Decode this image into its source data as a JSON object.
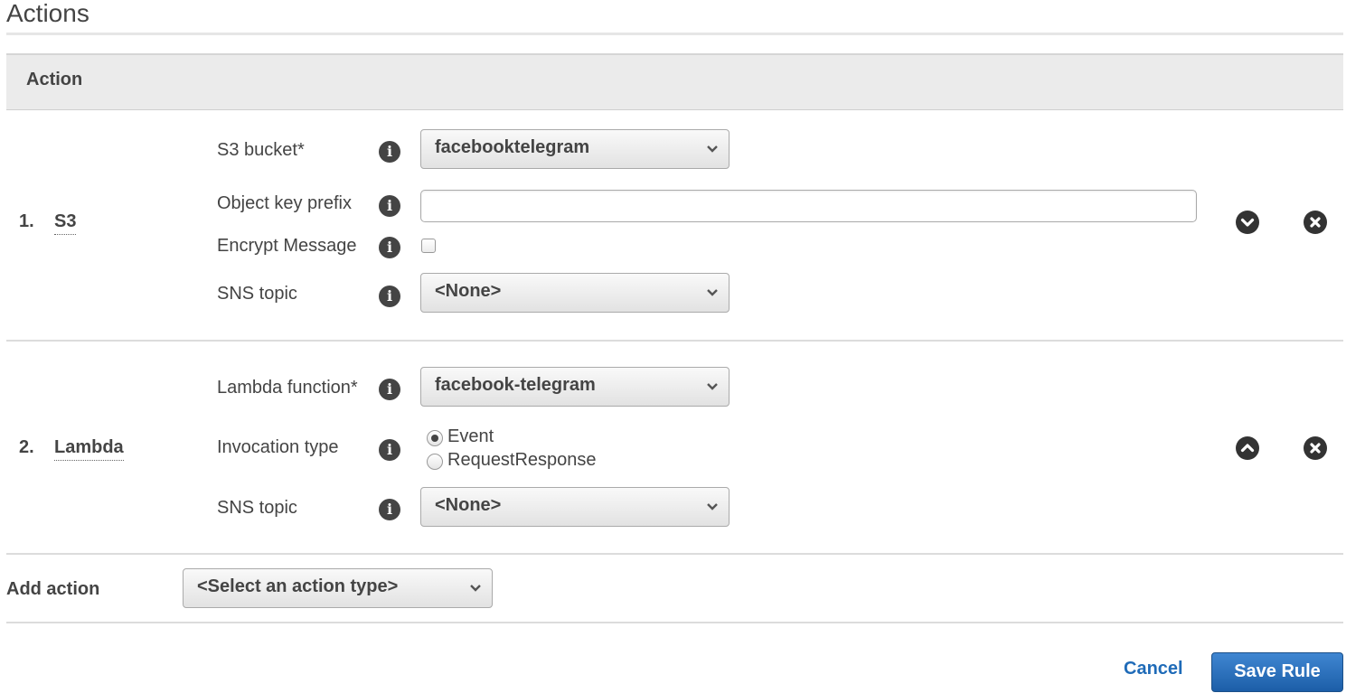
{
  "section": {
    "title": "Actions"
  },
  "table": {
    "header": "Action"
  },
  "actions": [
    {
      "number": "1.",
      "name": "S3",
      "fields": {
        "bucket_label": "S3 bucket*",
        "bucket_value": "facebooktelegram",
        "prefix_label": "Object key prefix",
        "prefix_value": "",
        "encrypt_label": "Encrypt Message",
        "encrypt_checked": false,
        "sns_label": "SNS topic",
        "sns_value": "<None>"
      },
      "controls": {
        "move": "move-down",
        "remove": "remove"
      }
    },
    {
      "number": "2.",
      "name": "Lambda",
      "fields": {
        "function_label": "Lambda function*",
        "function_value": "facebook-telegram",
        "invocation_label": "Invocation type",
        "invocation_options": [
          "Event",
          "RequestResponse"
        ],
        "invocation_selected": "Event",
        "sns_label": "SNS topic",
        "sns_value": "<None>"
      },
      "controls": {
        "move": "move-up",
        "remove": "remove"
      }
    }
  ],
  "add_action": {
    "label": "Add action",
    "placeholder": "<Select an action type>"
  },
  "footer": {
    "cancel_label": "Cancel",
    "save_label": "Save Rule"
  },
  "colors": {
    "link": "#1f6bb8",
    "primary_button": "#2b72c0",
    "header_bg": "#ebebeb"
  }
}
